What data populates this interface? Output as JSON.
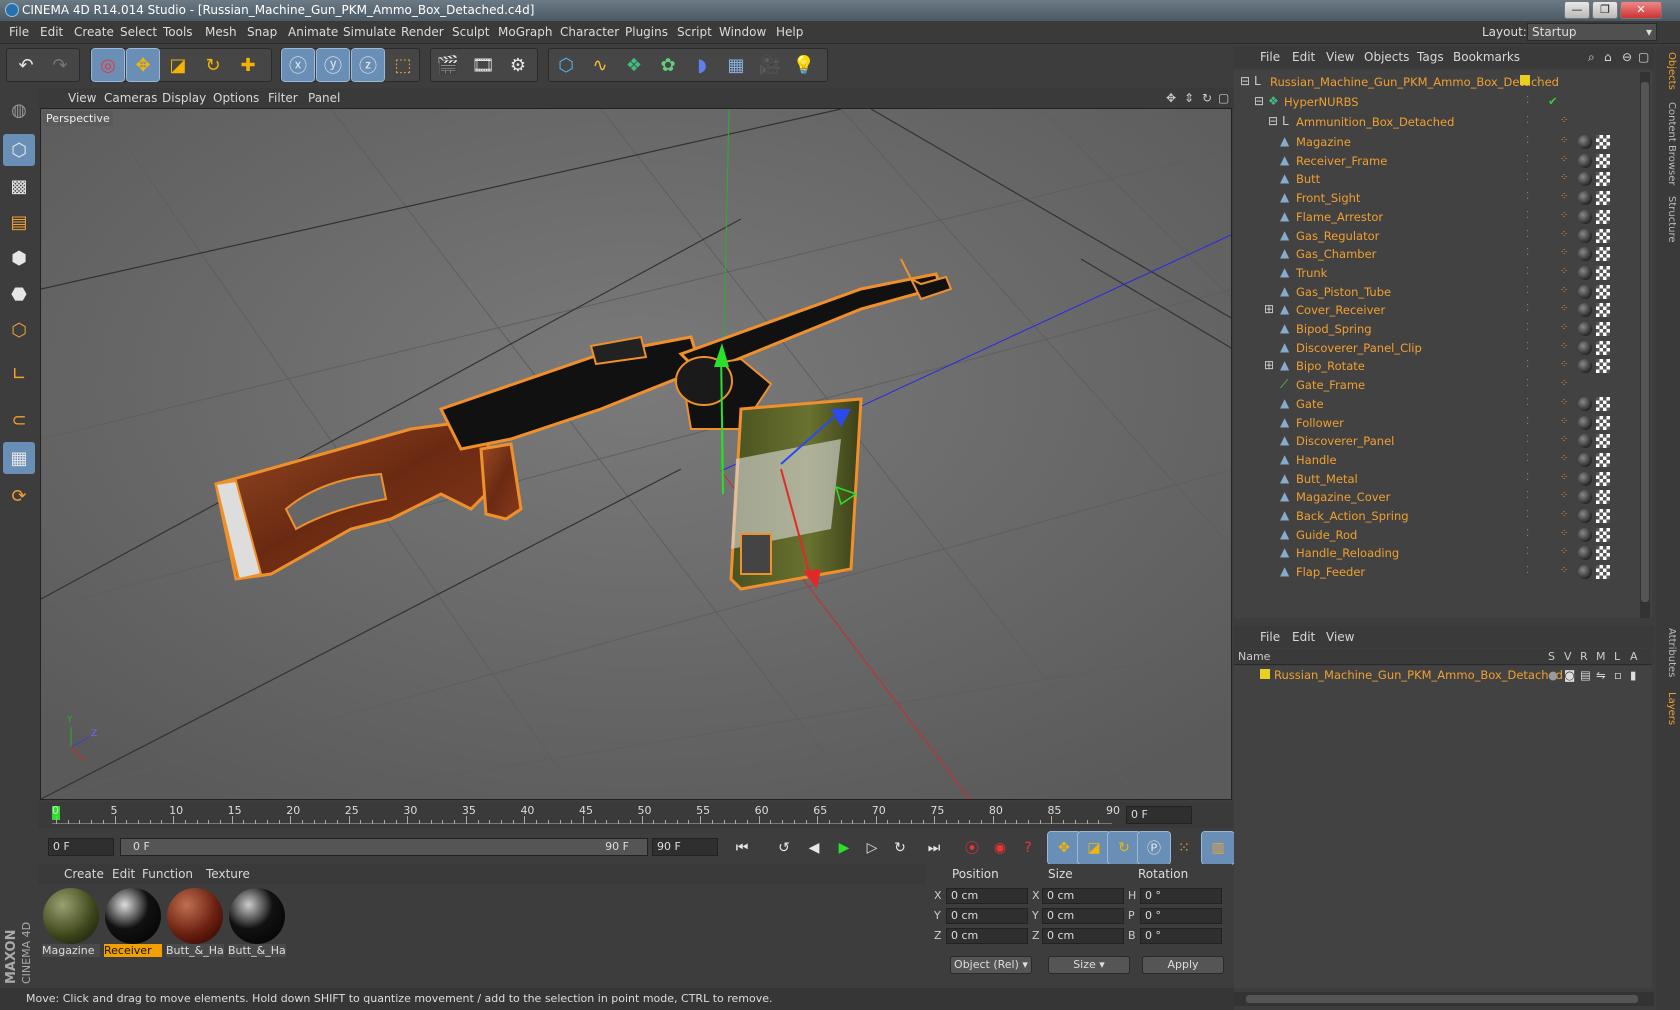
{
  "window": {
    "title": "CINEMA 4D R14.014 Studio - [Russian_Machine_Gun_PKM_Ammo_Box_Detached.c4d]",
    "buttons": [
      "—",
      "❐",
      "✕"
    ]
  },
  "menu": [
    "File",
    "Edit",
    "Create",
    "Select",
    "Tools",
    "Mesh",
    "Snap",
    "Animate",
    "Simulate",
    "Render",
    "Sculpt",
    "MoGraph",
    "Character",
    "Plugins",
    "Script",
    "Window",
    "Help"
  ],
  "layout": {
    "label": "Layout:",
    "value": "Startup"
  },
  "viewport": {
    "menu": [
      "View",
      "Cameras",
      "Display",
      "Options",
      "Filter",
      "Panel"
    ],
    "label": "Perspective",
    "axis_y": "Y",
    "axis_z": "Z"
  },
  "timeline": {
    "ticks": [
      "0",
      "5",
      "10",
      "15",
      "20",
      "25",
      "30",
      "35",
      "40",
      "45",
      "50",
      "55",
      "60",
      "65",
      "70",
      "75",
      "80",
      "85",
      "90"
    ],
    "frame_right": "0 F",
    "start": "0 F",
    "range_start": "0 F",
    "range_end": "90 F",
    "end": "90 F"
  },
  "materials": {
    "menu": [
      "Create",
      "Edit",
      "Function",
      "Texture"
    ],
    "items": [
      {
        "label": "Magazine",
        "color": "#4a5a28",
        "selected": false
      },
      {
        "label": "Receiver",
        "color": "#111111",
        "selected": true
      },
      {
        "label": "Butt_&_Ha",
        "color": "#7a2a14",
        "selected": false
      },
      {
        "label": "Butt_&_Ha",
        "color": "#111111",
        "selected": false
      }
    ]
  },
  "coords": {
    "headers": [
      "Position",
      "Size",
      "Rotation"
    ],
    "rows": [
      {
        "axis": "X",
        "pos": "0 cm",
        "sl": "X",
        "size": "0 cm",
        "rl": "H",
        "rot": "0 °"
      },
      {
        "axis": "Y",
        "pos": "0 cm",
        "sl": "Y",
        "size": "0 cm",
        "rl": "P",
        "rot": "0 °"
      },
      {
        "axis": "Z",
        "pos": "0 cm",
        "sl": "Z",
        "size": "0 cm",
        "rl": "B",
        "rot": "0 °"
      }
    ],
    "mode": "Object (Rel)",
    "size_mode": "Size",
    "apply": "Apply"
  },
  "status": "Move: Click and drag to move elements. Hold down SHIFT to quantize movement / add to the selection in point mode, CTRL to remove.",
  "brand": {
    "maxon": "MAXON",
    "c4d": "CINEMA 4D"
  },
  "objects": {
    "menu": [
      "File",
      "Edit",
      "View",
      "Objects",
      "Tags",
      "Bookmarks"
    ],
    "root": "Russian_Machine_Gun_PKM_Ammo_Box_Detached",
    "hypernurbs": "HyperNURBS",
    "group": "Ammunition_Box_Detached",
    "children": [
      "Magazine",
      "Receiver_Frame",
      "Butt",
      "Front_Sight",
      "Flame_Arrestor",
      "Gas_Regulator",
      "Gas_Chamber",
      "Trunk",
      "Gas_Piston_Tube",
      "Cover_Receiver",
      "Bipod_Spring",
      "Discoverer_Panel_Clip",
      "Bipo_Rotate",
      "Gate_Frame",
      "Gate",
      "Follower",
      "Discoverer_Panel",
      "Handle",
      "Butt_Metal",
      "Magazine_Cover",
      "Back_Action_Spring",
      "Guide_Rod",
      "Handle_Reloading",
      "Flap_Feeder"
    ]
  },
  "layers": {
    "menu": [
      "File",
      "Edit",
      "View"
    ],
    "columns": [
      "Name",
      "S",
      "V",
      "R",
      "M",
      "L",
      "A"
    ],
    "row": "Russian_Machine_Gun_PKM_Ammo_Box_Detached"
  },
  "sidetabs": [
    "Objects",
    "Content Browser",
    "Structure",
    "Attributes",
    "Layers"
  ],
  "colors": {
    "accent": "#f0a030",
    "active_tool": "#6a8fb7",
    "layer": "#e8d020"
  }
}
